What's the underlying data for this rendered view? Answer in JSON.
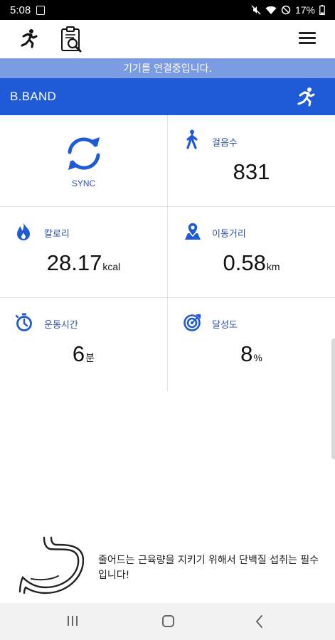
{
  "status_bar": {
    "time": "5:08",
    "battery": "17%",
    "icons": [
      "screenshot-icon",
      "mute-icon",
      "wifi-icon",
      "do-not-disturb-icon",
      "battery-icon"
    ]
  },
  "toolbar": {
    "icons": [
      "runner-icon",
      "report-search-icon",
      "hamburger-menu-icon"
    ]
  },
  "connection_banner": "기기를 연결중입니다.",
  "device_bar": {
    "name": "B.BAND",
    "icon": "runner-icon"
  },
  "sync": {
    "label": "SYNC",
    "icon": "sync-icon"
  },
  "stats": {
    "steps": {
      "label": "걸음수",
      "value": "831",
      "icon": "walking-icon"
    },
    "calories": {
      "label": "칼로리",
      "value": "28.17",
      "unit": "kcal",
      "icon": "flame-icon"
    },
    "distance": {
      "label": "이동거리",
      "value": "0.58",
      "unit": "km",
      "icon": "map-pin-icon"
    },
    "exercise_time": {
      "label": "운동시간",
      "value": "6",
      "unit": "분",
      "icon": "stopwatch-icon"
    },
    "achievement": {
      "label": "달성도",
      "value": "8",
      "unit": "%",
      "icon": "target-icon"
    }
  },
  "tip": {
    "text": "줄어드는 근육량을 지키기 위해서 단백질 섭취는 필수입니다!",
    "icon": "stomach-icon"
  },
  "navigation_bar": {
    "icons": [
      "recents-icon",
      "home-icon",
      "back-icon"
    ]
  },
  "colors": {
    "band_bar": "#1f5ad7",
    "connection_banner": "#7b9be3",
    "accent": "#1f5ad7"
  }
}
